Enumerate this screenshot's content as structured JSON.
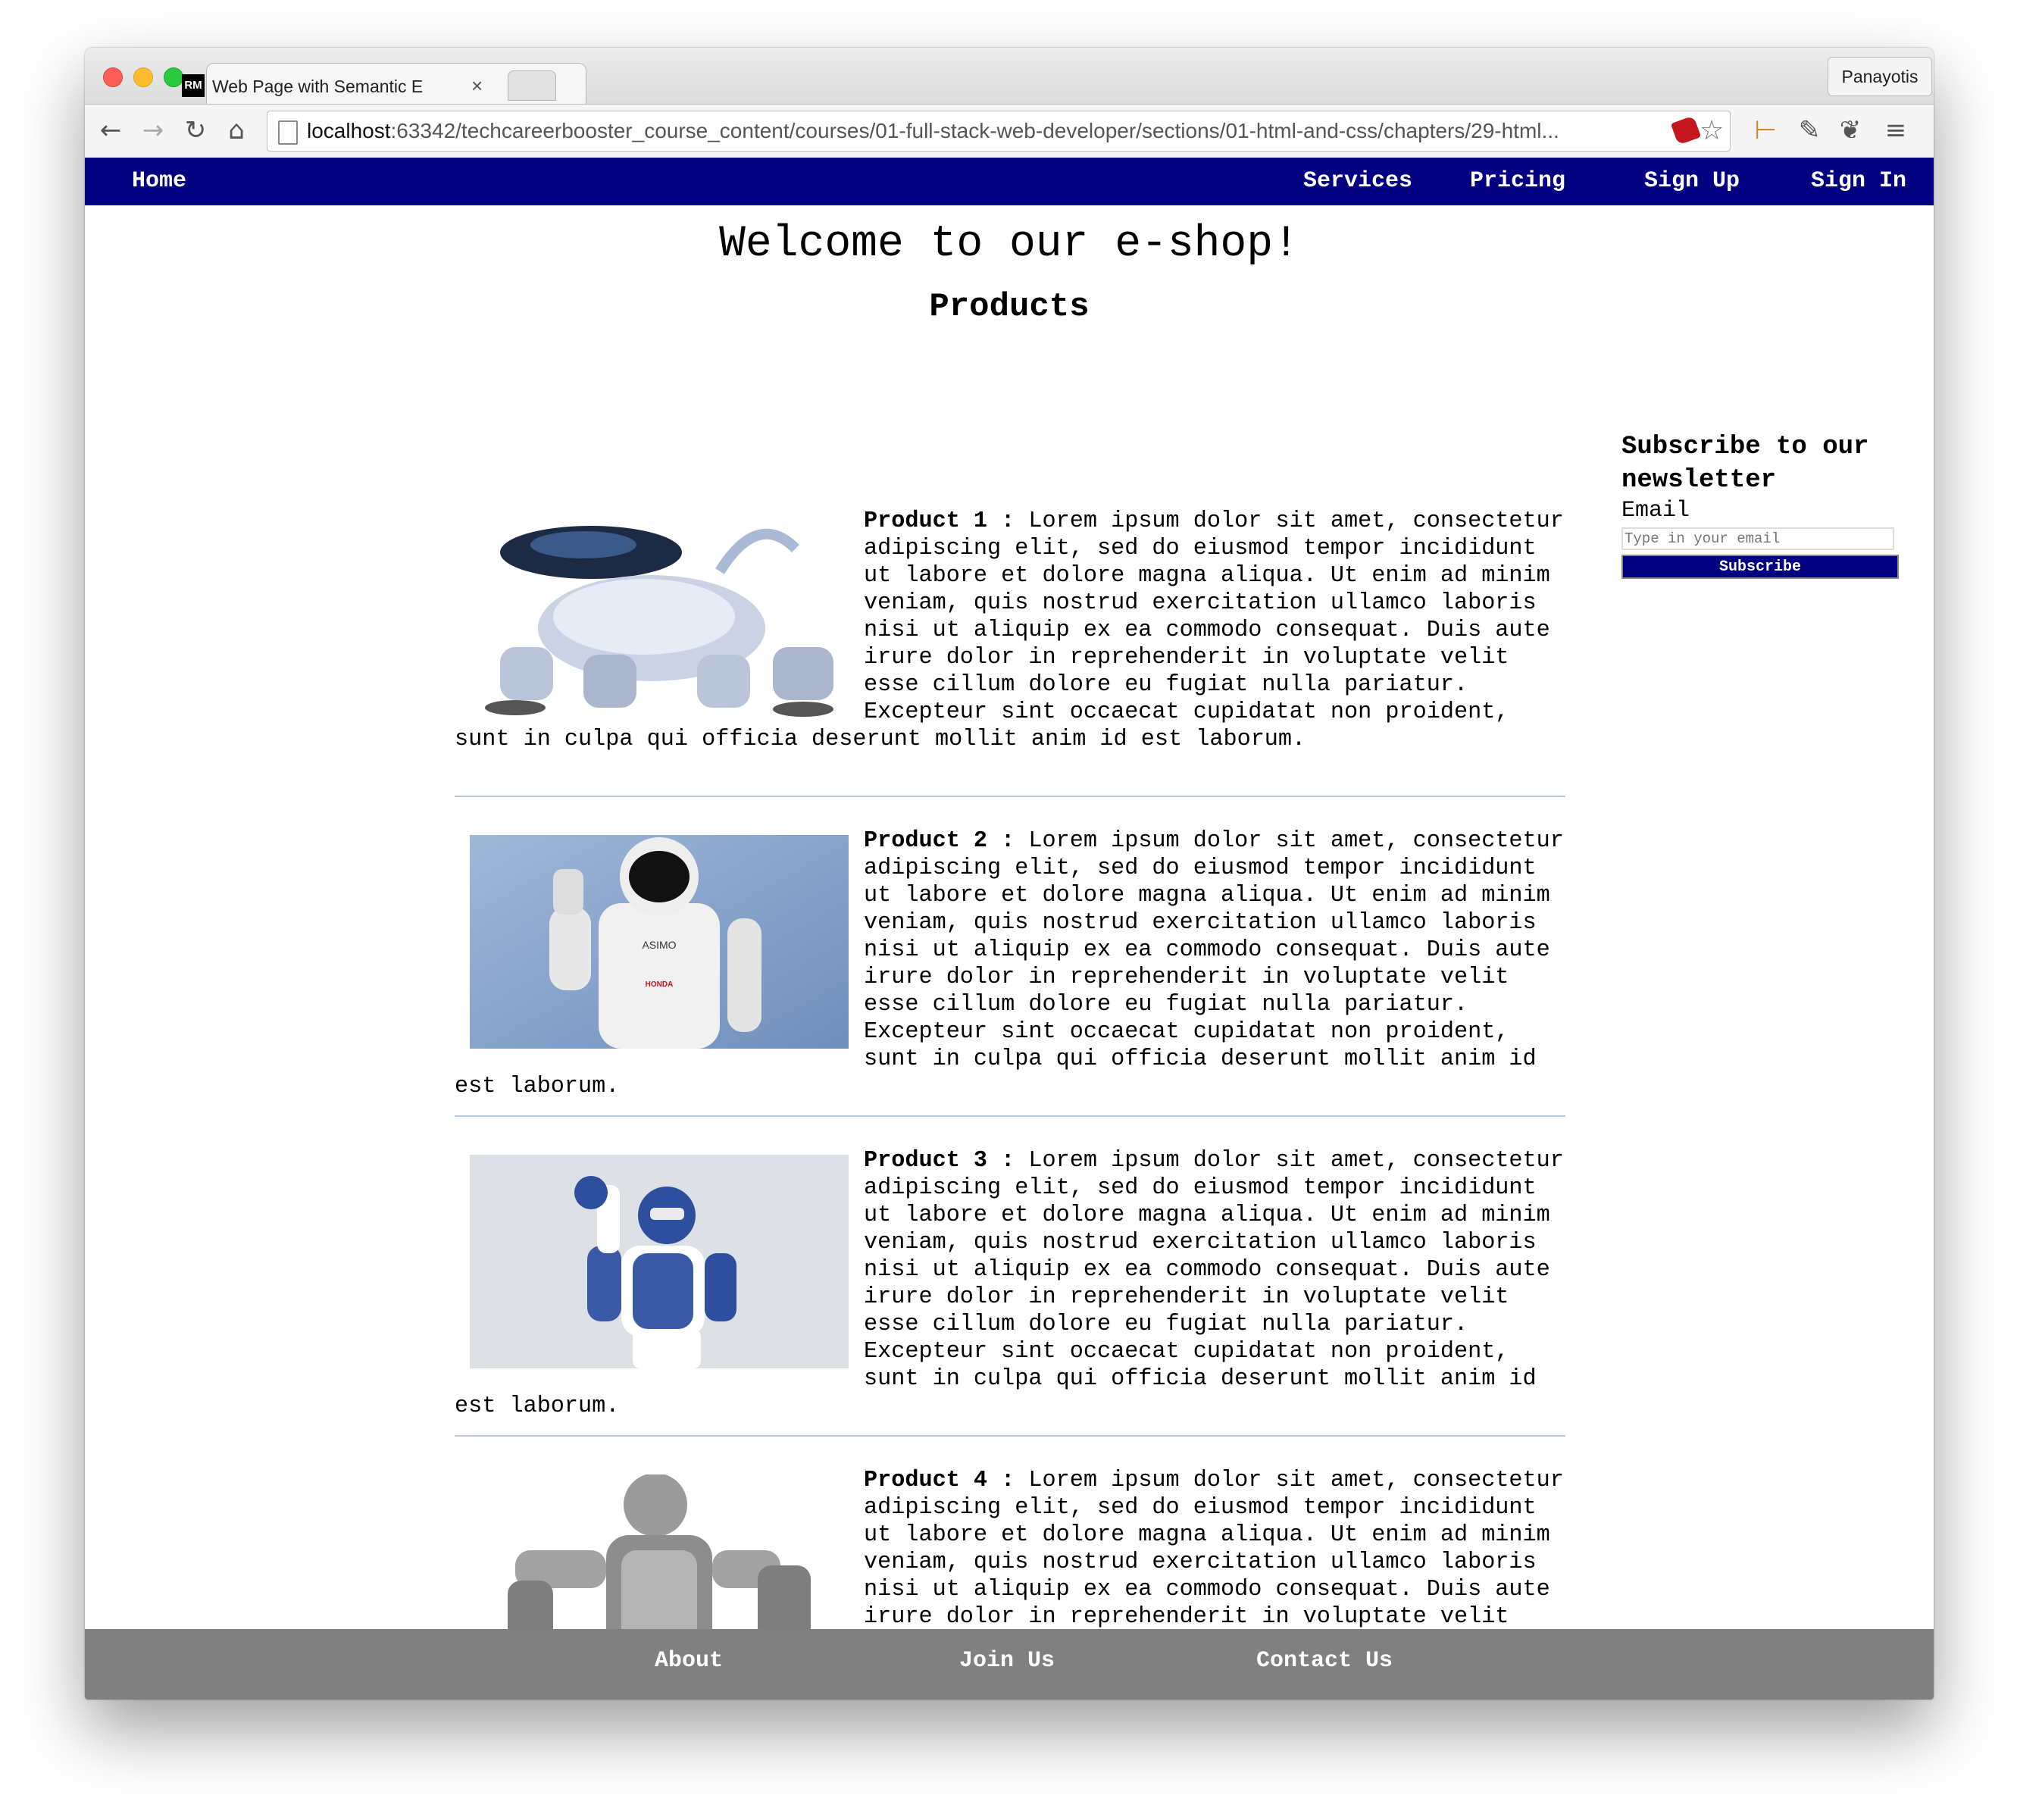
{
  "browser": {
    "tab_title": "Web Page with Semantic E",
    "tab_favicon_text": "RM",
    "tab_close": "×",
    "profile_name": "Panayotis",
    "url_host": "localhost",
    "url_rest": ":63342/techcareerbooster_course_content/courses/01-full-stack-web-developer/sections/01-html-and-css/chapters/29-html...",
    "icons": [
      "back-icon",
      "forward-icon",
      "reload-icon",
      "home-icon",
      "page-icon",
      "ruby-icon",
      "star-icon",
      "bookmark-icon",
      "eyedropper-icon",
      "evernote-icon",
      "menu-icon"
    ]
  },
  "nav": {
    "home": "Home",
    "services": "Services",
    "pricing": "Pricing",
    "sign_up": "Sign Up",
    "sign_in": "Sign In"
  },
  "page": {
    "title": "Welcome to our e-shop!",
    "products_heading": "Products"
  },
  "products": [
    {
      "label": "Product 1 :",
      "text": " Lorem ipsum dolor sit amet, consectetur adipiscing elit, sed do eiusmod tempor incididunt ut labore et dolore magna aliqua. Ut enim ad minim veniam, quis nostrud exercitation ullamco laboris nisi ut aliquip ex ea commodo consequat. Duis aute irure dolor in reprehenderit in voluptate velit esse cillum dolore eu fugiat nulla pariatur. Excepteur sint occaecat cupidatat non proident, sunt in culpa qui officia deserunt mollit anim id est laborum.",
      "image": "robot-dog-image"
    },
    {
      "label": "Product 2 :",
      "text": " Lorem ipsum dolor sit amet, consectetur adipiscing elit, sed do eiusmod tempor incididunt ut labore et dolore magna aliqua. Ut enim ad minim veniam, quis nostrud exercitation ullamco laboris nisi ut aliquip ex ea commodo consequat. Duis aute irure dolor in reprehenderit in voluptate velit esse cillum dolore eu fugiat nulla pariatur. Excepteur sint occaecat cupidatat non proident, sunt in culpa qui officia deserunt mollit anim id est laborum.",
      "image": "humanoid-robot-image",
      "image_text_1": "ASIMO",
      "image_text_2": "HONDA"
    },
    {
      "label": "Product 3 :",
      "text": " Lorem ipsum dolor sit amet, consectetur adipiscing elit, sed do eiusmod tempor incididunt ut labore et dolore magna aliqua. Ut enim ad minim veniam, quis nostrud exercitation ullamco laboris nisi ut aliquip ex ea commodo consequat. Duis aute irure dolor in reprehenderit in voluptate velit esse cillum dolore eu fugiat nulla pariatur. Excepteur sint occaecat cupidatat non proident, sunt in culpa qui officia deserunt mollit anim id est laborum.",
      "image": "blue-robot-image"
    },
    {
      "label": "Product 4 :",
      "text": " Lorem ipsum dolor sit amet, consectetur adipiscing elit, sed do eiusmod tempor incididunt ut labore et dolore magna aliqua. Ut enim ad minim veniam, quis nostrud exercitation ullamco laboris nisi ut aliquip ex ea commodo consequat. Duis aute irure dolor in reprehenderit in voluptate velit esse cillum dolore eu fugiat nulla pariatur. Excepteur sint occaecat cupidatat non proident, sunt in culpa qui officia deserunt mollit anim id est laborum.",
      "image": "metal-robot-image"
    }
  ],
  "newsletter": {
    "heading": "Subscribe to our newsletter",
    "email_label": "Email",
    "email_placeholder": "Type in your email",
    "email_value": "",
    "subscribe_label": "Subscribe"
  },
  "footer": {
    "about": "About",
    "join_us": "Join Us",
    "contact_us": "Contact Us"
  },
  "colors": {
    "nav_bg": "#000080",
    "footer_bg": "#808080",
    "separator": "#b7c6d8"
  }
}
